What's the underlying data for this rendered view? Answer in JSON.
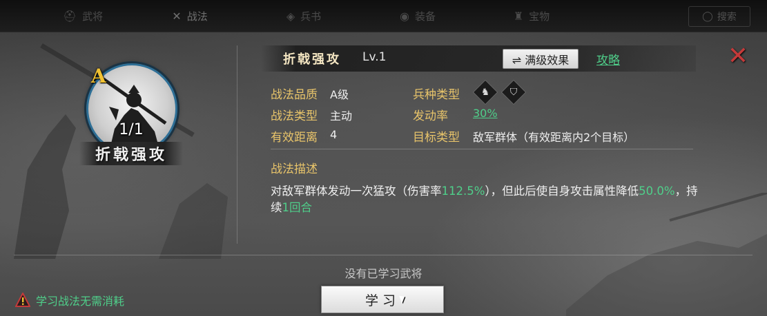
{
  "topbar": {
    "tabs": [
      {
        "label": "武将",
        "icon": "helmet-icon"
      },
      {
        "label": "战法",
        "icon": "crossed-swords-icon"
      },
      {
        "label": "兵书",
        "icon": "book-icon"
      },
      {
        "label": "装备",
        "icon": "armor-icon"
      },
      {
        "label": "宝物",
        "icon": "treasure-icon"
      }
    ],
    "search_label": "搜索"
  },
  "portrait": {
    "grade": "A",
    "count": "1/1",
    "name": "折戟强攻"
  },
  "header": {
    "skill_name": "折戟强攻",
    "level": "Lv.1",
    "max_effect_button": "⇌ 满级效果",
    "guide_link": "攻略",
    "close_icon": "close-icon"
  },
  "stats": {
    "quality_label": "战法品质",
    "quality_value": "A级",
    "type_label": "战法类型",
    "type_value": "主动",
    "range_label": "有效距离",
    "range_value": "4",
    "troop_label": "兵种类型",
    "troop_icons": [
      "cavalry-icon",
      "shield-icon"
    ],
    "rate_label": "发动率",
    "rate_value": "30%",
    "target_label": "目标类型",
    "target_value": "敌军群体（有效距离内2个目标）"
  },
  "description": {
    "title": "战法描述",
    "part1": "对敌军群体发动一次猛攻（伤害率",
    "hl1": "112.5%",
    "part2": "），但此后使自身攻击属性降低",
    "hl2": "50.0%",
    "part3": "，持续",
    "hl3": "1回合"
  },
  "footer": {
    "no_general": "没有已学习武将",
    "learn_button": "学习",
    "notice": "学习战法无需消耗"
  },
  "colors": {
    "gold_label": "#e8c46a",
    "green_highlight": "#4fcf8a",
    "close_red": "#c43a3a",
    "grade_yellow": "#f1c232"
  }
}
